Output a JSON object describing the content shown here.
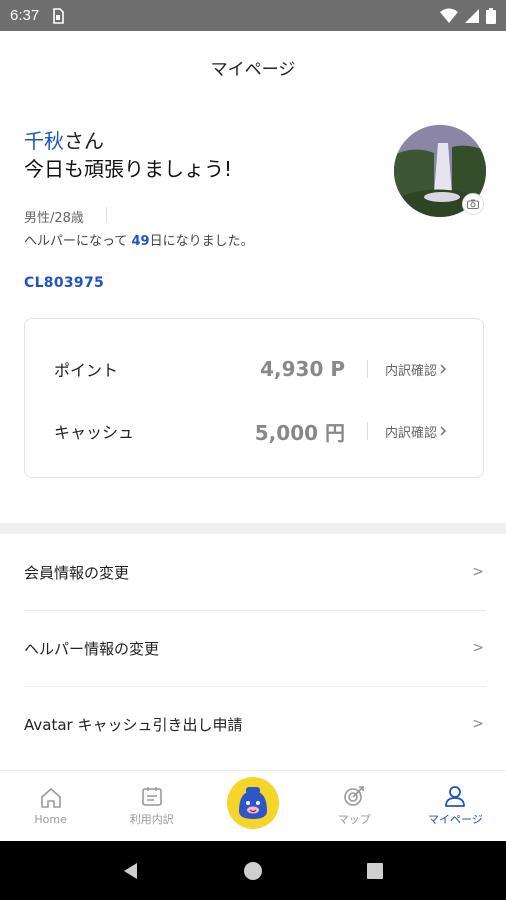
{
  "status_bar": {
    "time": "6:37"
  },
  "header": {
    "title": "マイページ"
  },
  "profile": {
    "name": "千秋",
    "name_suffix": "さん",
    "greeting": "今日も頑張りましょう!",
    "gender_age": "男性/28歳",
    "helper_prefix": "ヘルパーになって ",
    "helper_days": "49",
    "helper_suffix": "日になりました。",
    "member_id": "CL803975"
  },
  "wallet": {
    "points_label": "ポイント",
    "points_value": "4,930 P",
    "cash_label": "キャッシュ",
    "cash_value": "5,000 円",
    "detail_label": "内訳確認"
  },
  "menu": {
    "items": [
      {
        "label": "会員情報の変更"
      },
      {
        "label": "ヘルパー情報の変更"
      },
      {
        "label": "Avatar キャッシュ引き出し申請"
      }
    ],
    "chevron": ">"
  },
  "bottom_nav": {
    "items": [
      {
        "label": "Home",
        "icon": "home-icon"
      },
      {
        "label": "利用内訳",
        "icon": "calendar-icon"
      },
      {
        "label": "",
        "icon": "mascot-icon"
      },
      {
        "label": "マップ",
        "icon": "map-target-icon"
      },
      {
        "label": "マイページ",
        "icon": "person-icon"
      }
    ]
  },
  "colors": {
    "accent": "#1f53c4",
    "mascot_bg": "#f5d52a",
    "status_bar": "#6e6e6e"
  }
}
